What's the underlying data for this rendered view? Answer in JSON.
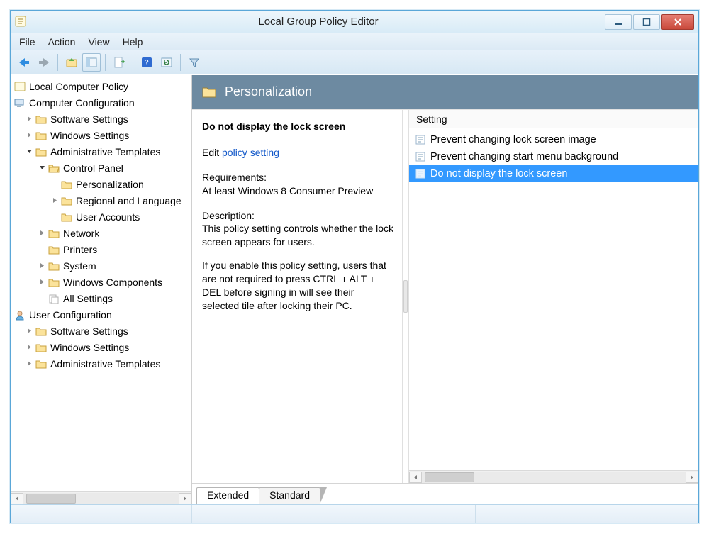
{
  "window": {
    "title": "Local Group Policy Editor"
  },
  "menu": {
    "file": "File",
    "action": "Action",
    "view": "View",
    "help": "Help"
  },
  "tree": {
    "root": "Local Computer Policy",
    "comp_config": "Computer Configuration",
    "software_settings": "Software Settings",
    "windows_settings": "Windows Settings",
    "admin_templates": "Administrative Templates",
    "control_panel": "Control Panel",
    "personalization": "Personalization",
    "regional": "Regional and Language",
    "user_accounts": "User Accounts",
    "network": "Network",
    "printers": "Printers",
    "system": "System",
    "windows_components": "Windows Components",
    "all_settings": "All Settings",
    "user_config": "User Configuration",
    "u_software_settings": "Software Settings",
    "u_windows_settings": "Windows Settings",
    "u_admin_templates": "Administrative Templates"
  },
  "pane": {
    "title": "Personalization"
  },
  "detail": {
    "policy_name": "Do not display the lock screen",
    "edit_label": "Edit",
    "edit_link": "policy setting",
    "req_label": "Requirements:",
    "req_text": "At least Windows 8 Consumer Preview",
    "desc_label": "Description:",
    "desc_text": "This policy setting controls whether the lock screen appears for users.",
    "desc_text2": "If you enable this policy setting, users that are not required to press CTRL + ALT + DEL before signing in will see their selected tile after locking their PC."
  },
  "list": {
    "header": "Setting",
    "items": [
      "Prevent changing lock screen image",
      "Prevent changing start menu background",
      "Do not display the lock screen"
    ]
  },
  "tabs": {
    "extended": "Extended",
    "standard": "Standard"
  }
}
